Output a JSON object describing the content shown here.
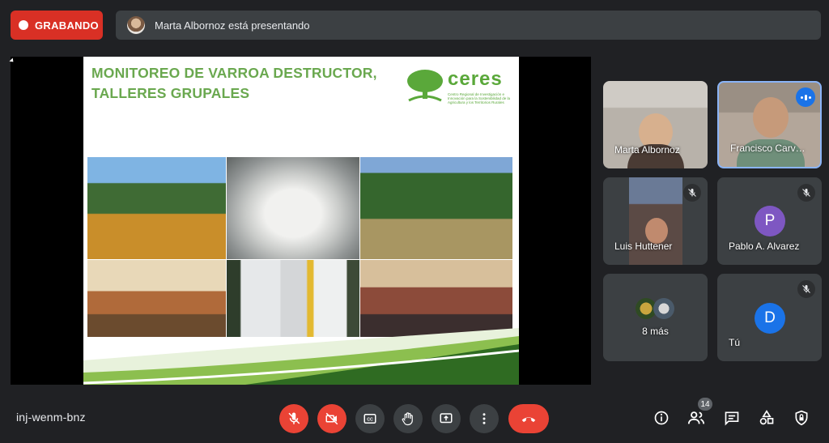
{
  "recording": {
    "label": "GRABANDO",
    "color": "#d93025"
  },
  "presenting_banner": {
    "text": "Marta Albornoz está presentando"
  },
  "slide": {
    "title_line1": "MONITOREO DE VARROA DESTRUCTOR,",
    "title_line2": "TALLERES GRUPALES",
    "logo_word": "ceres",
    "logo_subtitle": "Centro Regional de Investigación e Innovación para la Sostenibilidad de la Agricultura y los Territorios Rurales"
  },
  "participants": [
    {
      "name": "Marta Albornoz",
      "muted": false
    },
    {
      "name": "Francisco Carv…",
      "muted": false,
      "speaking": true
    },
    {
      "name": "Luis Huttener",
      "muted": true
    },
    {
      "name": "Pablo A. Alvarez",
      "muted": true,
      "initial": "P",
      "avatar_color": "#7e57c2"
    },
    {
      "name": "8 más",
      "muted": false
    },
    {
      "name": "Tú",
      "muted": true,
      "initial": "D",
      "avatar_color": "#1a73e8"
    }
  ],
  "meeting": {
    "code": "inj-wenm-bnz",
    "participant_count": "14"
  },
  "controls": [
    {
      "name": "mic-off-button",
      "icon": "mic-off-icon"
    },
    {
      "name": "camera-off-button",
      "icon": "videocam-off-icon"
    },
    {
      "name": "captions-button",
      "icon": "cc-icon"
    },
    {
      "name": "raise-hand-button",
      "icon": "hand-icon"
    },
    {
      "name": "present-button",
      "icon": "present-icon"
    },
    {
      "name": "more-options-button",
      "icon": "more-vert-icon"
    },
    {
      "name": "leave-call-button",
      "icon": "call-end-icon"
    }
  ],
  "right_controls": [
    {
      "name": "meeting-details-button",
      "icon": "info-icon"
    },
    {
      "name": "people-button",
      "icon": "people-icon"
    },
    {
      "name": "chat-button",
      "icon": "chat-icon"
    },
    {
      "name": "activities-button",
      "icon": "shapes-icon"
    },
    {
      "name": "host-controls-button",
      "icon": "lock-shield-icon"
    }
  ]
}
